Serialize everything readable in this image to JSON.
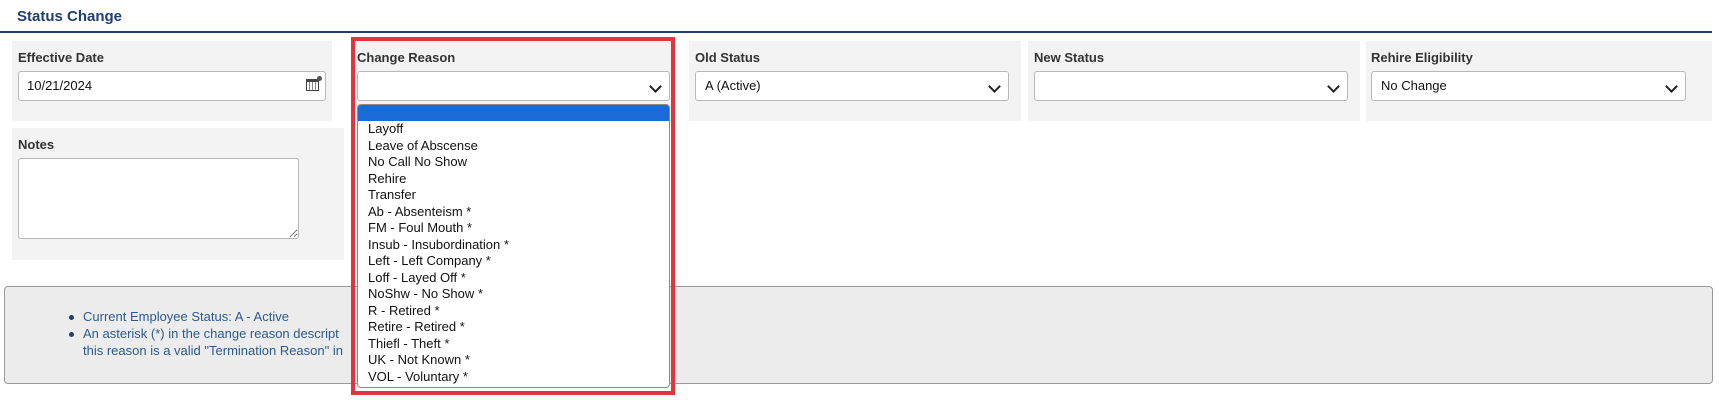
{
  "section": {
    "title": "Status Change"
  },
  "effective_date": {
    "label": "Effective Date",
    "value": "10/21/2024"
  },
  "change_reason": {
    "label": "Change Reason",
    "value": "",
    "options": [
      "",
      "Layoff",
      "Leave of Abscense",
      "No Call No Show",
      "Rehire",
      "Transfer",
      "Ab - Absenteism *",
      "FM - Foul Mouth *",
      "Insub - Insubordination *",
      "Left - Left Company *",
      "Loff - Layed Off *",
      "NoShw - No Show *",
      "R - Retired *",
      "Retire - Retired *",
      "Thiefl - Theft *",
      "UK - Not Known *",
      "VOL - Voluntary *"
    ]
  },
  "old_status": {
    "label": "Old Status",
    "value": "A (Active)"
  },
  "new_status": {
    "label": "New Status",
    "value": ""
  },
  "rehire_eligibility": {
    "label": "Rehire Eligibility",
    "value": "No Change"
  },
  "notes": {
    "label": "Notes",
    "value": ""
  },
  "info": {
    "line1": "Current Employee Status: A - Active",
    "line2": "An asterisk (*) in the change reason descript",
    "line3": "this reason is a valid \"Termination Reason\" in"
  },
  "colors": {
    "title": "#1f3f6e",
    "highlight": "#e3343c",
    "selected_option": "#1a6ad8",
    "info_text": "#2d5a8e"
  }
}
